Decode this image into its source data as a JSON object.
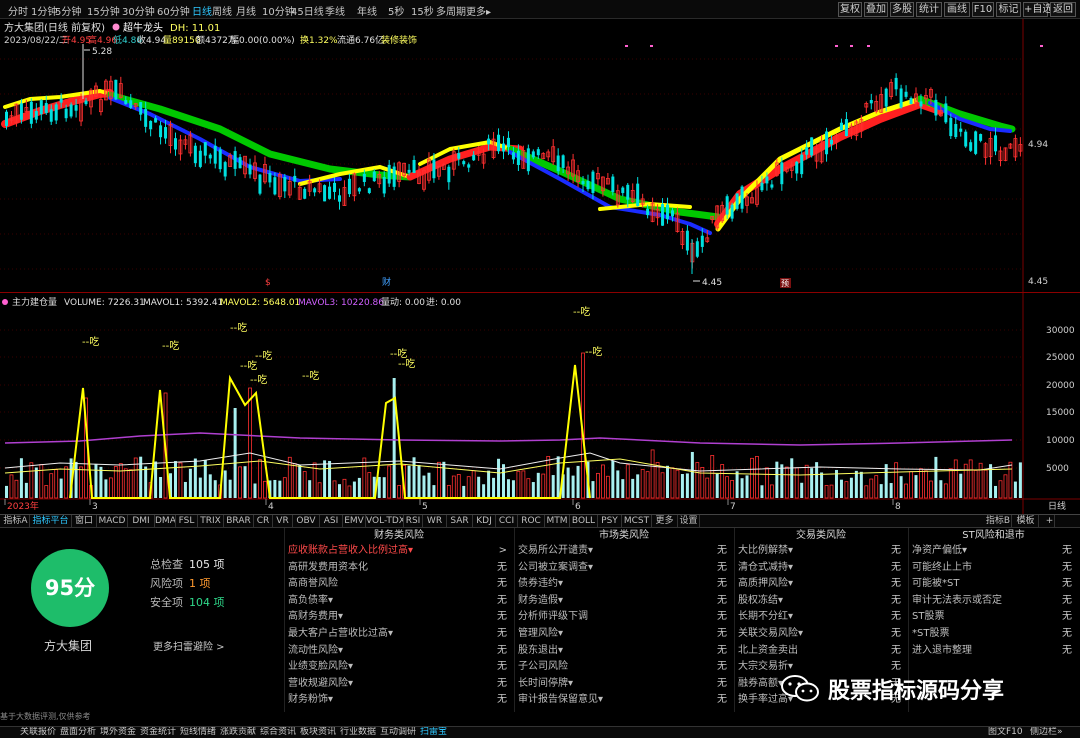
{
  "toolbar": {
    "periods": [
      "分时",
      "1分钟",
      "5分钟",
      "15分钟",
      "30分钟",
      "60分钟",
      "日线",
      "周线",
      "月线",
      "10分钟",
      "45日线",
      "季线",
      "年线",
      "5秒",
      "15秒",
      "多周期",
      "更多▸"
    ],
    "active_period": "日线",
    "right_buttons": [
      "复权",
      "叠加",
      "多股",
      "统计",
      "画线",
      "F10",
      "标记",
      "+自选",
      "返回"
    ]
  },
  "kline_header": {
    "title": "方大集团(日线 前复权)",
    "dot_label": "超牛龙头",
    "dh_label": "DH: 11.01",
    "date": "2023/08/22/二",
    "open": "开4.95",
    "high": "高4.96",
    "low": "低4.86",
    "close": "收4.94",
    "volume": "量89150",
    "amount": "额4372万",
    "change": "幅0.00(0.00%)",
    "turnover": "换1.32%",
    "float": "流通6.76亿",
    "sector": "装修装饰"
  },
  "kline_axis": {
    "price_labels": [
      "4.94",
      "4.45"
    ],
    "max_label": "5.28",
    "min_label": "4.45"
  },
  "markers": {
    "s_label": "$",
    "cai_label": "财",
    "zeng_label": "预"
  },
  "volume_header": {
    "name": "主力建仓量",
    "volume": "VOLUME: 7226.31",
    "mavol1": "MAVOL1: 5392.41",
    "mavol2": "MAVOL2: 5648.01",
    "mavol3": "MAVOL3: 10220.86",
    "liangdong": "量动: 0.00",
    "jin": "进: 0.00"
  },
  "volume_axis": {
    "labels": [
      "30000",
      "25000",
      "20000",
      "15000",
      "10000",
      "5000"
    ],
    "period_label": "日线"
  },
  "time_axis": {
    "labels": [
      "2023年",
      "3",
      "4",
      "5",
      "6",
      "7",
      "8"
    ]
  },
  "chi_label": "--吃",
  "indicator_tabs": [
    "指标A",
    "指标平台",
    "窗口",
    "MACD",
    "DMI",
    "DMA",
    "FSL",
    "TRIX",
    "BRAR",
    "CR",
    "VR",
    "OBV",
    "ASI",
    "EMV",
    "VOL-TDX",
    "RSI",
    "WR",
    "SAR",
    "KDJ",
    "CCI",
    "ROC",
    "MTM",
    "BOLL",
    "PSY",
    "MCST",
    "更多",
    "设置"
  ],
  "indicator_active": "指标平台",
  "indicator_right": [
    "指标B",
    "模板",
    "+"
  ],
  "risk": {
    "score": "95分",
    "company": "方大集团",
    "total_label": "总检查",
    "total": "105 项",
    "risk_label": "风险项",
    "risk_count": "1 项",
    "safe_label": "安全项",
    "safe_count": "104 项",
    "more_scan": "更多扫雷避险 >",
    "disclaimer": "基于大数据评测,仅供参考",
    "columns": [
      {
        "title": "财务类风险",
        "rows": [
          {
            "label": "应收账款占营收入比例过高▾",
            "value": ">",
            "highlight": true
          },
          {
            "label": "高研发费用资本化",
            "value": "无"
          },
          {
            "label": "高商誉风险",
            "value": "无"
          },
          {
            "label": "高负债率▾",
            "value": "无"
          },
          {
            "label": "高财务费用▾",
            "value": "无"
          },
          {
            "label": "最大客户占营收比过高▾",
            "value": "无"
          },
          {
            "label": "流动性风险▾",
            "value": "无"
          },
          {
            "label": "业绩变脸风险▾",
            "value": "无"
          },
          {
            "label": "营收规避风险▾",
            "value": "无"
          },
          {
            "label": "财务粉饰▾",
            "value": "无"
          }
        ]
      },
      {
        "title": "市场类风险",
        "rows": [
          {
            "label": "交易所公开谴责▾",
            "value": "无"
          },
          {
            "label": "公司被立案调查▾",
            "value": "无"
          },
          {
            "label": "债券违约▾",
            "value": "无"
          },
          {
            "label": "财务造假▾",
            "value": "无"
          },
          {
            "label": "分析师评级下调",
            "value": "无"
          },
          {
            "label": "管理风险▾",
            "value": "无"
          },
          {
            "label": "股东退出▾",
            "value": "无"
          },
          {
            "label": "子公司风险",
            "value": "无"
          },
          {
            "label": "长时间停牌▾",
            "value": "无"
          },
          {
            "label": "审计报告保留意见▾",
            "value": "无"
          }
        ]
      },
      {
        "title": "交易类风险",
        "rows": [
          {
            "label": "大比例解禁▾",
            "value": "无"
          },
          {
            "label": "清仓式减持▾",
            "value": "无"
          },
          {
            "label": "高质押风险▾",
            "value": "无"
          },
          {
            "label": "股权冻结▾",
            "value": "无"
          },
          {
            "label": "长期不分红▾",
            "value": "无"
          },
          {
            "label": "关联交易风险▾",
            "value": "无"
          },
          {
            "label": "北上资金卖出",
            "value": "无"
          },
          {
            "label": "大宗交易折▾",
            "value": "无"
          },
          {
            "label": "融券高额▾",
            "value": "无"
          },
          {
            "label": "换手率过高▾",
            "value": "无"
          }
        ]
      },
      {
        "title": "ST风险和退市",
        "rows": [
          {
            "label": "净资产偏低▾",
            "value": "无"
          },
          {
            "label": "可能终止上市",
            "value": "无"
          },
          {
            "label": "可能被*ST",
            "value": "无"
          },
          {
            "label": "审计无法表示或否定",
            "value": "无"
          },
          {
            "label": "ST股票",
            "value": "无"
          },
          {
            "label": "*ST股票",
            "value": "无"
          },
          {
            "label": "进入退市整理",
            "value": "无"
          }
        ]
      }
    ]
  },
  "watermark": "股票指标源码分享",
  "bottom_tabs": [
    "关联报价",
    "盘面分析",
    "境外资金",
    "资金统计",
    "短线情绪",
    "涨跌贡献",
    "综合资讯",
    "板块资讯",
    "行业数据",
    "互动调研",
    "扫雷宝"
  ],
  "bottom_active": "扫雷宝",
  "bottom_right": [
    "图文F10",
    "侧边栏»"
  ],
  "colors": {
    "up": "#ff3030",
    "down": "#00e0e0",
    "ma_yellow": "#ffff00",
    "ma_green": "#00c800",
    "ma_blue": "#1a2cff",
    "ma_red": "#ff2020",
    "mavol_purple": "#b040d0",
    "score_green": "#1ebd6a"
  }
}
